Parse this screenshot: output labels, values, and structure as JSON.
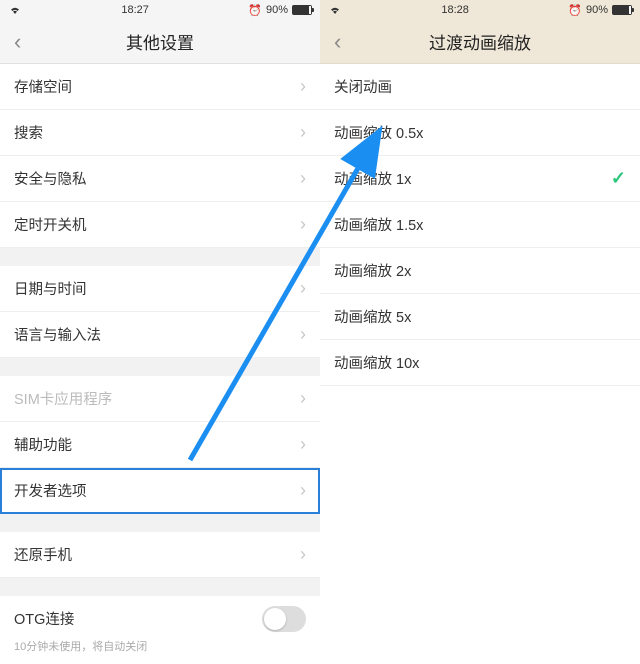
{
  "left": {
    "status": {
      "time": "18:27",
      "battery": "90%"
    },
    "title": "其他设置",
    "groups": [
      {
        "rows": [
          {
            "label": "存储空间",
            "chevron": true
          },
          {
            "label": "搜索",
            "chevron": true
          },
          {
            "label": "安全与隐私",
            "chevron": true
          },
          {
            "label": "定时开关机",
            "chevron": true
          }
        ]
      },
      {
        "rows": [
          {
            "label": "日期与时间",
            "chevron": true
          },
          {
            "label": "语言与输入法",
            "chevron": true
          }
        ]
      },
      {
        "rows": [
          {
            "label": "SIM卡应用程序",
            "chevron": true,
            "disabled": true
          },
          {
            "label": "辅助功能",
            "chevron": true
          },
          {
            "label": "开发者选项",
            "chevron": true,
            "selected": true
          }
        ]
      },
      {
        "rows": [
          {
            "label": "还原手机",
            "chevron": true
          }
        ]
      },
      {
        "rows": [
          {
            "label": "OTG连接",
            "toggle": true,
            "sub": "10分钟未使用，将自动关闭"
          }
        ]
      }
    ]
  },
  "right": {
    "status": {
      "time": "18:28",
      "battery": "90%"
    },
    "title": "过渡动画缩放",
    "options": [
      {
        "label": "关闭动画"
      },
      {
        "label": "动画缩放 0.5x"
      },
      {
        "label": "动画缩放 1x",
        "checked": true
      },
      {
        "label": "动画缩放 1.5x"
      },
      {
        "label": "动画缩放 2x"
      },
      {
        "label": "动画缩放 5x"
      },
      {
        "label": "动画缩放 10x"
      }
    ]
  }
}
